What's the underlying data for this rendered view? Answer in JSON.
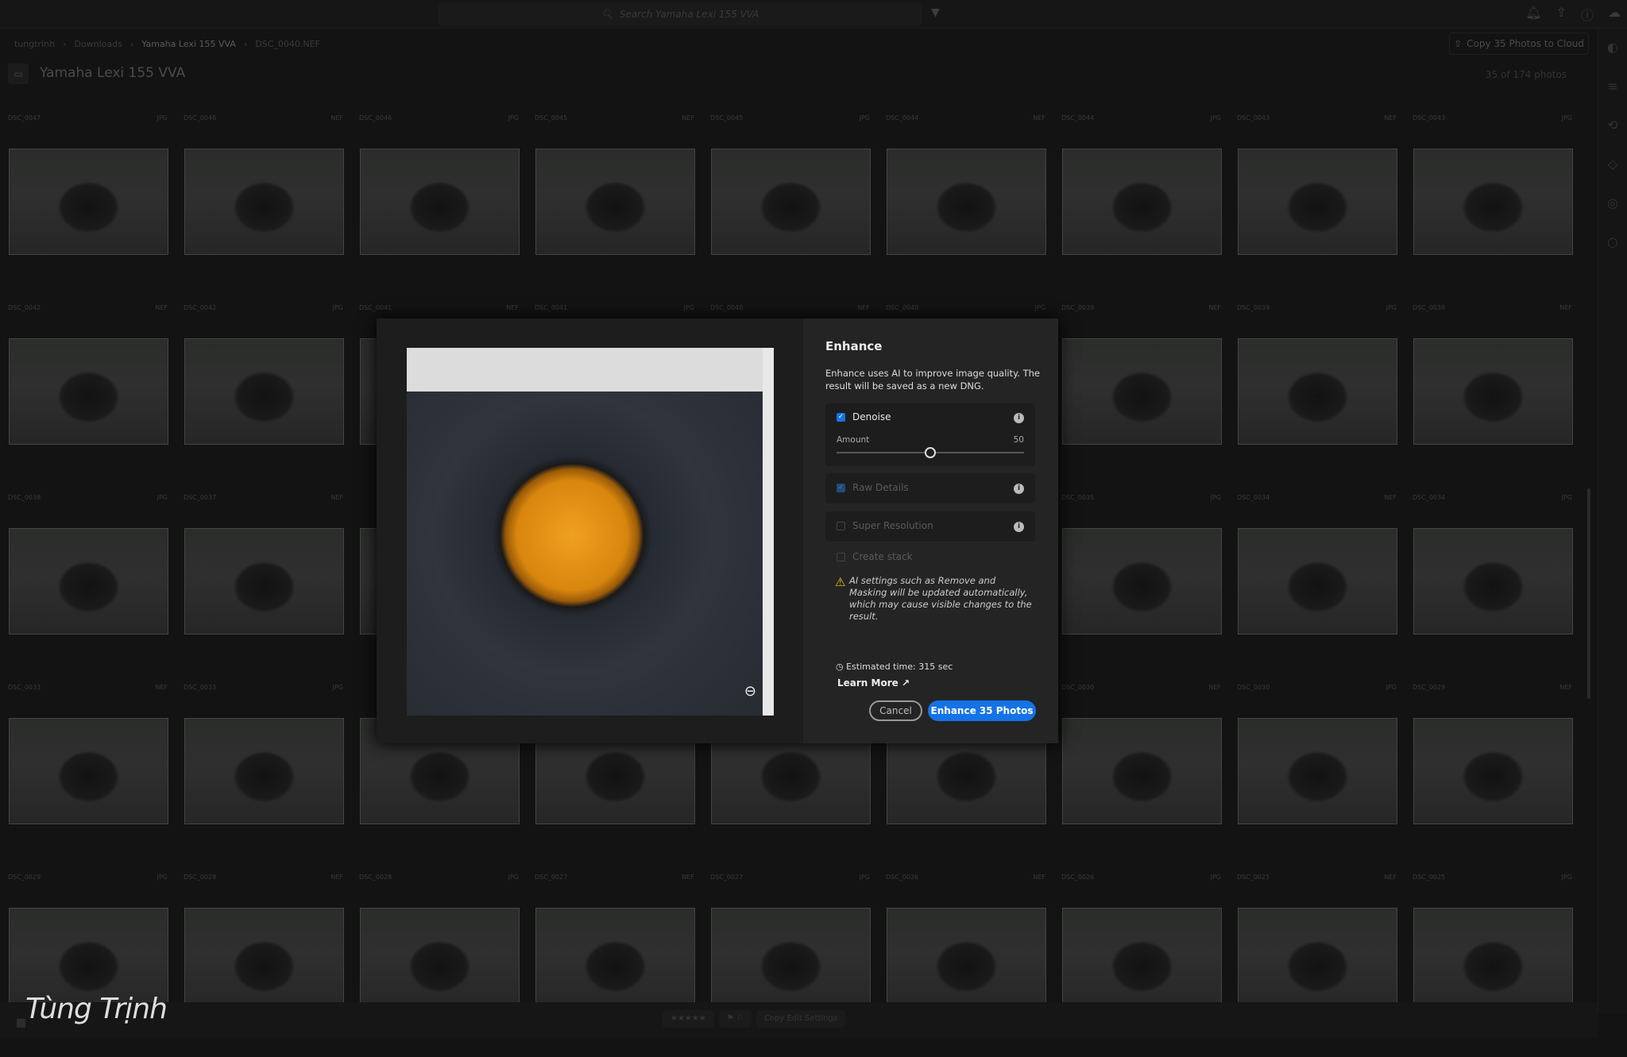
{
  "topbar": {
    "search_placeholder": "Search Yamaha Lexi 155 VVA"
  },
  "breadcrumb": [
    "tungtrinh",
    "Downloads",
    "Yamaha Lexi 155 VVA",
    "DSC_0040.NEF"
  ],
  "album": {
    "title": "Yamaha Lexi 155 VVA",
    "count": "35 of 174 photos",
    "copy_button": "Copy 35 Photos to Cloud"
  },
  "grid": [
    [
      [
        "DSC_0047",
        "JPG"
      ],
      [
        "DSC_0046",
        "NEF"
      ],
      [
        "DSC_0046",
        "JPG"
      ],
      [
        "DSC_0045",
        "NEF"
      ],
      [
        "DSC_0045",
        "JPG"
      ],
      [
        "DSC_0044",
        "NEF"
      ],
      [
        "DSC_0044",
        "JPG"
      ],
      [
        "DSC_0043",
        "NEF"
      ],
      [
        "DSC_0043",
        "JPG"
      ]
    ],
    [
      [
        "DSC_0042",
        "NEF"
      ],
      [
        "DSC_0042",
        "JPG"
      ],
      [
        "DSC_0041",
        "NEF"
      ],
      [
        "DSC_0041",
        "JPG"
      ],
      [
        "DSC_0040",
        "NEF"
      ],
      [
        "DSC_0040",
        "JPG"
      ],
      [
        "DSC_0039",
        "NEF"
      ],
      [
        "DSC_0039",
        "JPG"
      ],
      [
        "DSC_0038",
        "NEF"
      ]
    ],
    [
      [
        "DSC_0038",
        "JPG"
      ],
      [
        "DSC_0037",
        "NEF"
      ],
      [
        "",
        ""
      ],
      [
        "",
        ""
      ],
      [
        "",
        ""
      ],
      [
        "",
        ""
      ],
      [
        "DSC_0035",
        "JPG"
      ],
      [
        "DSC_0034",
        "NEF"
      ],
      [
        "DSC_0034",
        "JPG"
      ]
    ],
    [
      [
        "DSC_0033",
        "NEF"
      ],
      [
        "DSC_0033",
        "JPG"
      ],
      [
        "",
        ""
      ],
      [
        "",
        ""
      ],
      [
        "",
        ""
      ],
      [
        "",
        ""
      ],
      [
        "DSC_0030",
        "NEF"
      ],
      [
        "DSC_0030",
        "JPG"
      ],
      [
        "DSC_0029",
        "NEF"
      ]
    ],
    [
      [
        "DSC_0029",
        "JPG"
      ],
      [
        "DSC_0028",
        "NEF"
      ],
      [
        "DSC_0028",
        "JPG"
      ],
      [
        "DSC_0027",
        "NEF"
      ],
      [
        "DSC_0027",
        "JPG"
      ],
      [
        "DSC_0026",
        "NEF"
      ],
      [
        "DSC_0026",
        "JPG"
      ],
      [
        "DSC_0025",
        "NEF"
      ],
      [
        "DSC_0025",
        "JPG"
      ]
    ]
  ],
  "bottombar": {
    "stars": "★★★★★",
    "flags": "⚑ ⚐",
    "copy_edit": "Copy Edit Settings"
  },
  "watermark": "Tùng Trịnh",
  "dialog": {
    "title": "Enhance",
    "description": "Enhance uses AI to improve image quality. The result will be saved as a new DNG.",
    "denoise": {
      "label": "Denoise",
      "checked": true,
      "amount_label": "Amount",
      "amount": 50
    },
    "raw_details": {
      "label": "Raw Details",
      "checked": true,
      "disabled": true
    },
    "super_resolution": {
      "label": "Super Resolution",
      "checked": false,
      "disabled": true
    },
    "create_stack": {
      "label": "Create stack",
      "checked": false,
      "disabled": true
    },
    "warning": "AI settings such as Remove and Masking will be updated automatically, which may cause visible changes to the result.",
    "estimated_time": "Estimated time: 315 sec",
    "learn_more": "Learn More",
    "cancel": "Cancel",
    "confirm": "Enhance 35 Photos"
  },
  "colors": {
    "accent": "#1473e6",
    "warning": "#f0c020"
  }
}
